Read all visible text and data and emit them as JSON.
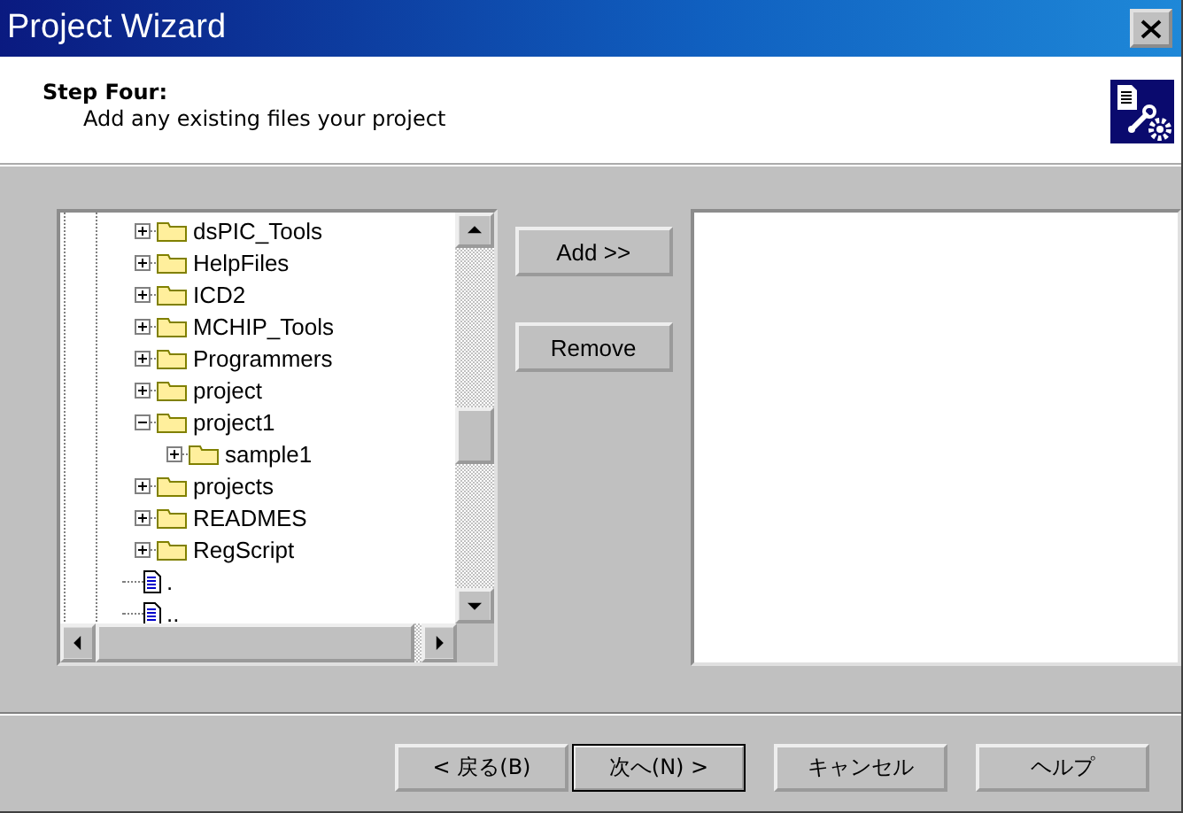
{
  "window": {
    "title": "Project Wizard"
  },
  "header": {
    "step": "Step Four:",
    "description": "Add any existing files your project"
  },
  "tree": [
    {
      "kind": "folder",
      "label": "dsPIC_Tools",
      "expanded": false
    },
    {
      "kind": "folder",
      "label": "HelpFiles",
      "expanded": false
    },
    {
      "kind": "folder",
      "label": "ICD2",
      "expanded": false
    },
    {
      "kind": "folder",
      "label": "MCHIP_Tools",
      "expanded": false
    },
    {
      "kind": "folder",
      "label": "Programmers",
      "expanded": false
    },
    {
      "kind": "folder",
      "label": "project",
      "expanded": false
    },
    {
      "kind": "folder",
      "label": "project1",
      "expanded": true,
      "children": [
        {
          "kind": "folder",
          "label": "sample1",
          "expanded": false
        }
      ]
    },
    {
      "kind": "folder",
      "label": "projects",
      "expanded": false
    },
    {
      "kind": "folder",
      "label": "READMES",
      "expanded": false
    },
    {
      "kind": "folder",
      "label": "RegScript",
      "expanded": false
    },
    {
      "kind": "file",
      "label": "."
    },
    {
      "kind": "file",
      "label": ".."
    }
  ],
  "actions": [
    "Add >>",
    "Remove"
  ],
  "buttons": [
    {
      "label": "< 戻る(B)",
      "default": false
    },
    {
      "label": "次へ(N) >",
      "default": true
    },
    {
      "label": "キャンセル",
      "default": false
    },
    {
      "label": "ヘルプ",
      "default": false
    }
  ]
}
